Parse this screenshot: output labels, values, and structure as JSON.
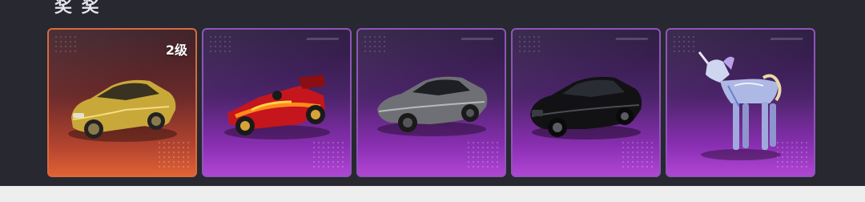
{
  "section": {
    "title": "奖 奖"
  },
  "items": [
    {
      "icon": "gold-coupe-car-icon",
      "tier": "orange",
      "level_badge": "2级"
    },
    {
      "icon": "red-flame-racer-car-icon",
      "tier": "purple"
    },
    {
      "icon": "silver-sports-car-icon",
      "tier": "purple"
    },
    {
      "icon": "black-sedan-car-icon",
      "tier": "purple"
    },
    {
      "icon": "crystal-unicorn-mount-icon",
      "tier": "purple"
    }
  ],
  "colors": {
    "background": "#272830",
    "tier_orange": "#d96a3c",
    "tier_purple": "#8e55b8"
  }
}
